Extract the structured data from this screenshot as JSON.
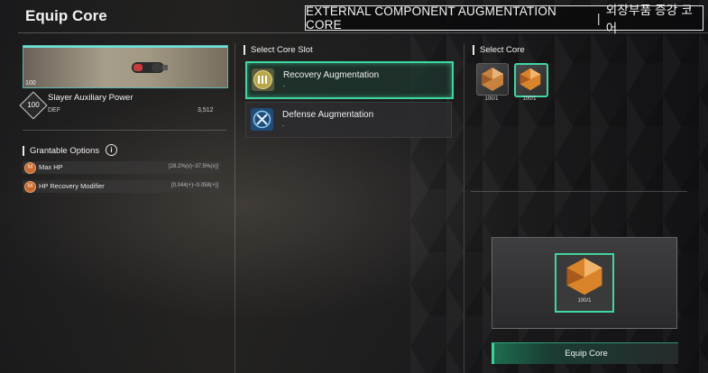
{
  "header": {
    "title": "Equip Core",
    "event_banner": "EXTERNAL COMPONENT AUGMENTATION CORE",
    "event_banner_korean": "외장부품 증강 코어",
    "separator": "|"
  },
  "item": {
    "level_small": "100",
    "level": "100",
    "name": "Slayer Auxiliary Power",
    "stat_label": "DEF",
    "stat_value": "3,512"
  },
  "grantable": {
    "title": "Grantable Options",
    "info_icon": "i",
    "options": [
      {
        "icon": "M",
        "name": "Max HP",
        "value": "[28.2%(x)~37.5%(x)]"
      },
      {
        "icon": "M",
        "name": "HP Recovery Modifier",
        "value": "[0.044(+)~0.058(+)]"
      }
    ]
  },
  "core_slot": {
    "title": "Select Core Slot",
    "slots": [
      {
        "name": "Recovery Augmentation",
        "sub": "-",
        "selected": true
      },
      {
        "name": "Defense Augmentation",
        "sub": "-",
        "selected": false
      }
    ]
  },
  "select_core": {
    "title": "Select Core",
    "cores": [
      {
        "count": "100/1",
        "selected": false
      },
      {
        "count": "100/1",
        "selected": true
      }
    ]
  },
  "preview": {
    "count": "100/1"
  },
  "equip_button": "Equip Core",
  "colors": {
    "accent": "#3fd6a0",
    "item_border": "#5ab9b3",
    "option_icon": "#c96a2c"
  }
}
